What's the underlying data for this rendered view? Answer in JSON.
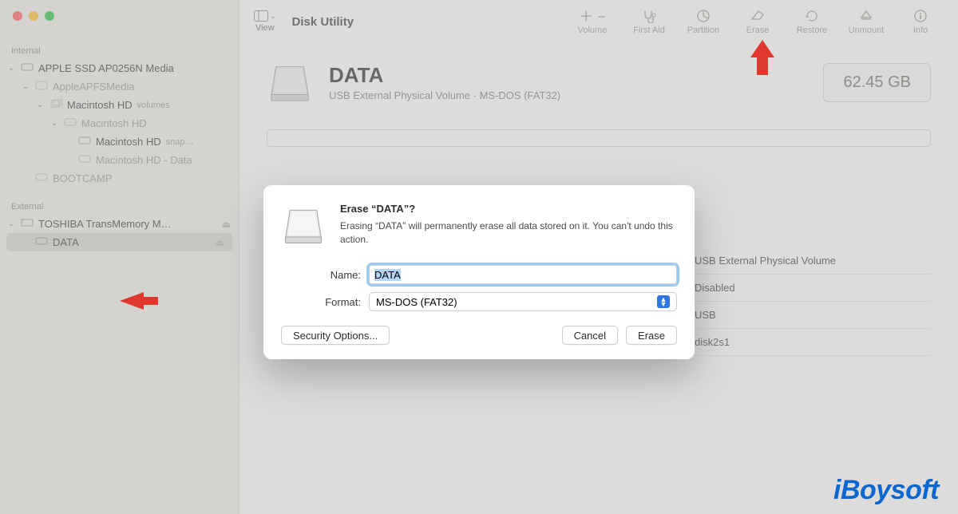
{
  "app": {
    "title": "Disk Utility"
  },
  "toolbar": {
    "view": "View",
    "volume": "Volume",
    "first_aid": "First Aid",
    "partition": "Partition",
    "erase": "Erase",
    "restore": "Restore",
    "unmount": "Unmount",
    "info": "Info"
  },
  "sidebar": {
    "internal_label": "Internal",
    "external_label": "External",
    "items": {
      "apple_ssd": "APPLE SSD AP0256N Media",
      "apfs": "AppleAPFSMedia",
      "mac_hd_container": "Macintosh HD",
      "mac_hd_container_sub": "volumes",
      "mac_hd_vol": "Macintosh HD",
      "mac_hd_snap": "Macintosh HD",
      "mac_hd_snap_sub": "snap…",
      "mac_hd_data": "Macintosh HD - Data",
      "bootcamp": "BOOTCAMP",
      "toshiba": "TOSHIBA TransMemory M…",
      "data": "DATA"
    }
  },
  "volume": {
    "name": "DATA",
    "subtitle": "USB External Physical Volume · MS-DOS (FAT32)",
    "size": "62.45 GB"
  },
  "info_rows": {
    "type": {
      "v": "USB External Physical Volume"
    },
    "owners": {
      "v": "Disabled"
    },
    "connection": {
      "v": "USB"
    },
    "device": {
      "v": "disk2s1"
    }
  },
  "dialog": {
    "title": "Erase “DATA”?",
    "message": "Erasing “DATA” will permanently erase all data stored on it. You can't undo this action.",
    "name_label": "Name:",
    "name_value": "DATA",
    "format_label": "Format:",
    "format_value": "MS-DOS (FAT32)",
    "security": "Security Options...",
    "cancel": "Cancel",
    "erase": "Erase"
  },
  "watermark": "iBoysoft"
}
